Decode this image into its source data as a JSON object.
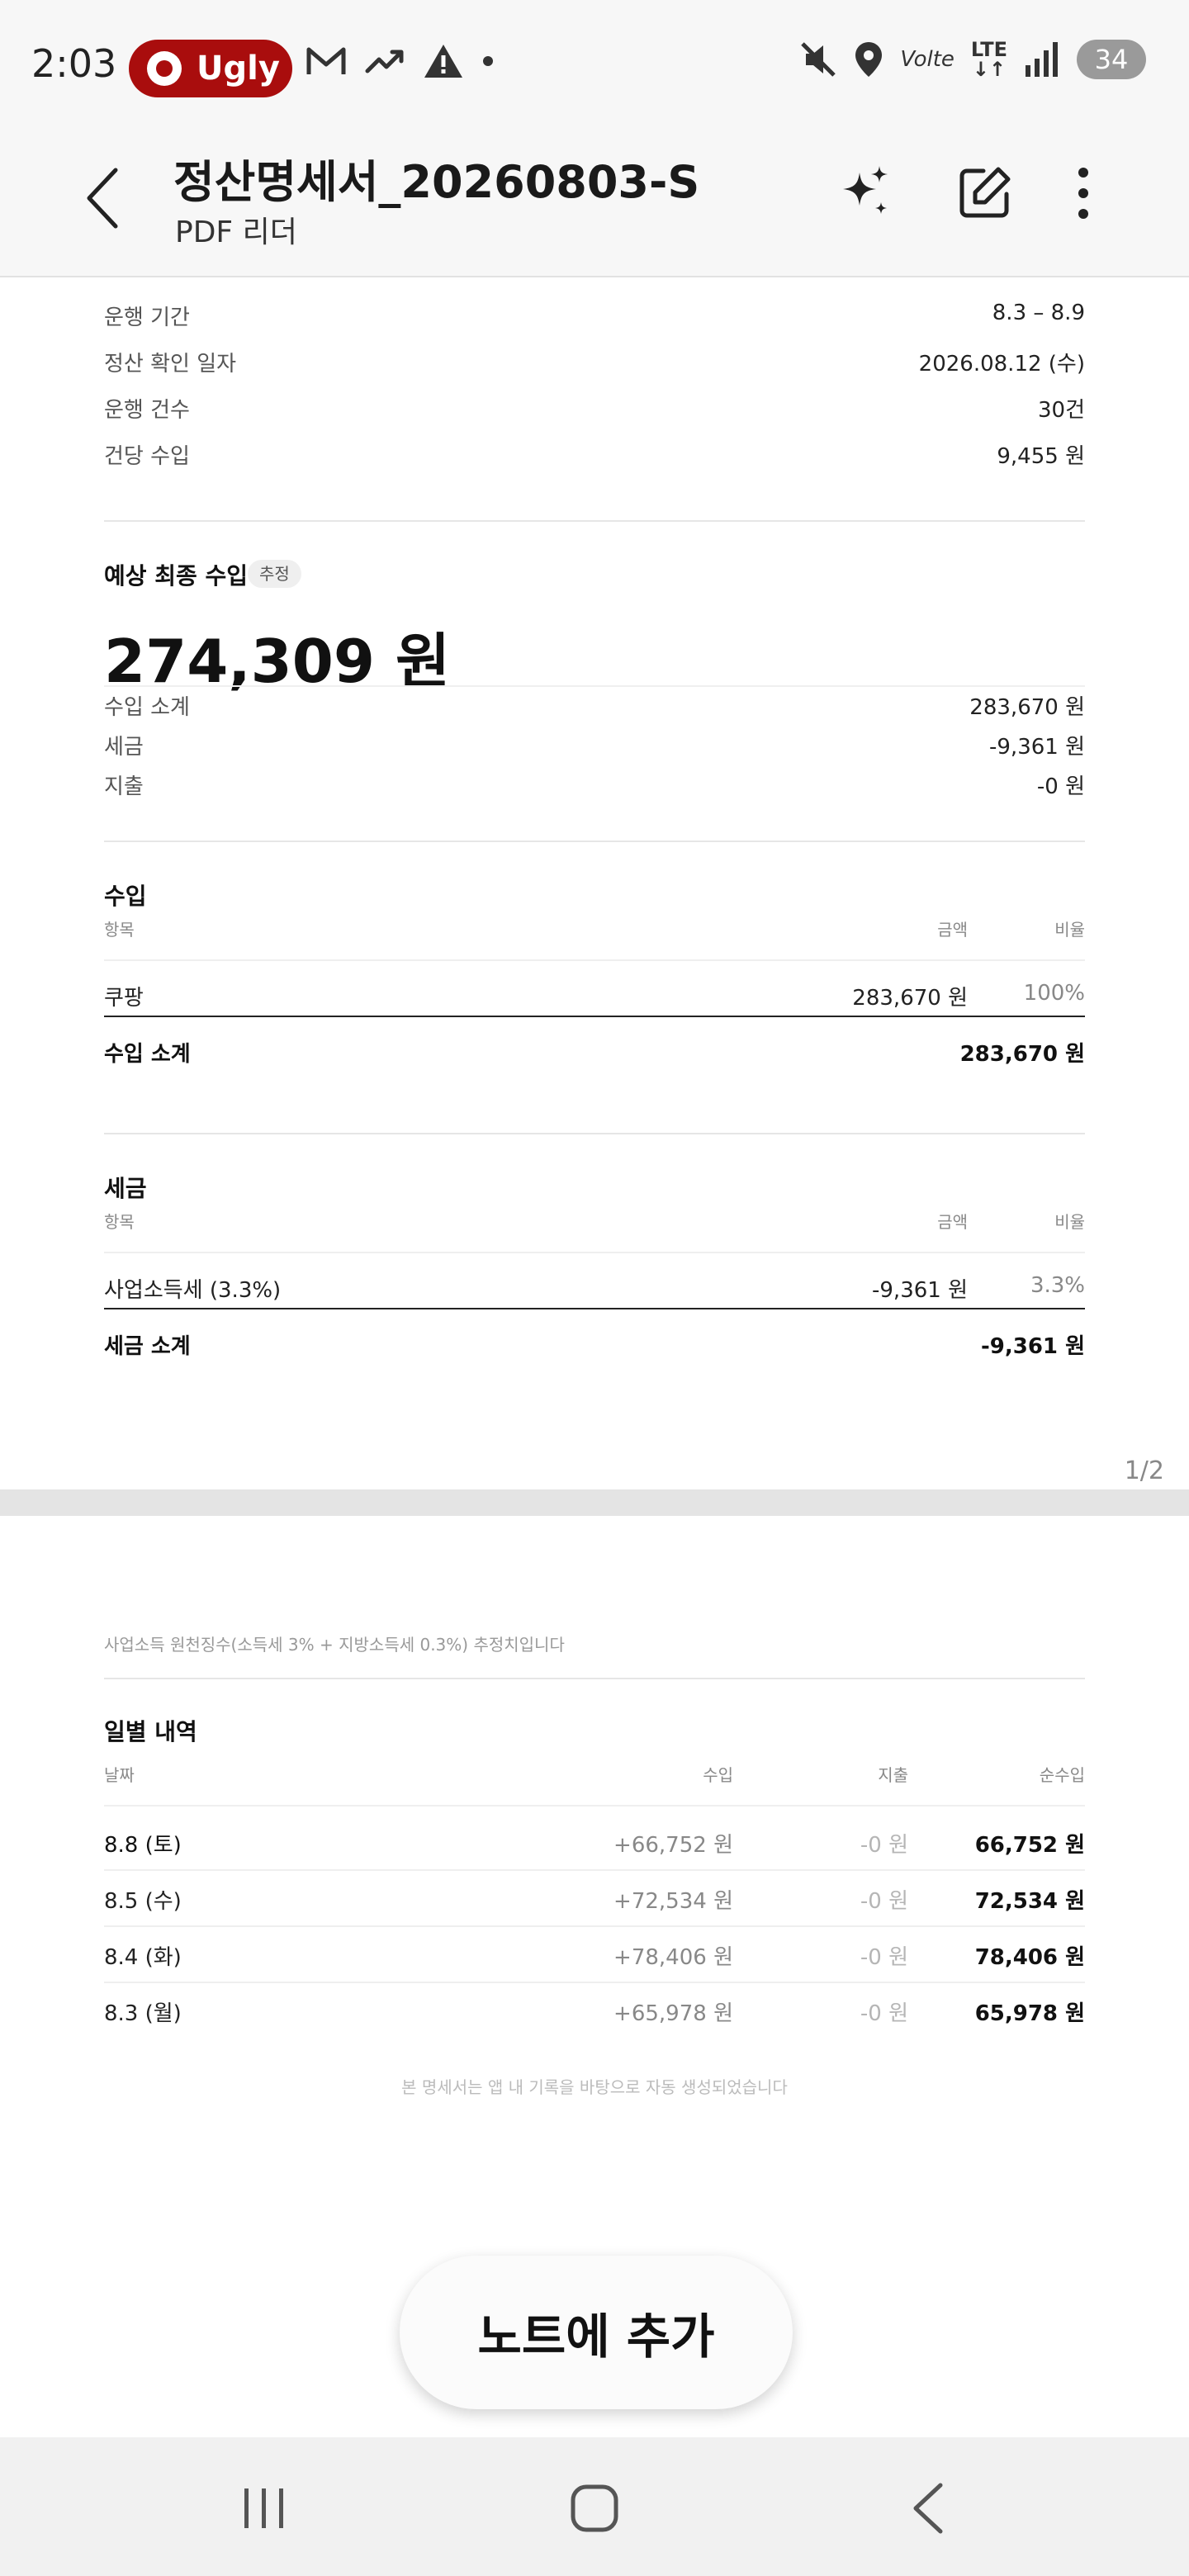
{
  "status_bar": {
    "time": "2:03",
    "pill_label": "Ugly",
    "battery": "34",
    "network": "LTE",
    "volte": "Volte",
    "icons_left": [
      "record-icon",
      "gmail-icon",
      "trending-icon",
      "warning-icon",
      "dot-icon"
    ],
    "icons_right": [
      "mute-icon",
      "location-icon",
      "volte-icon",
      "lte-icon",
      "signal-icon",
      "battery-icon"
    ]
  },
  "app_bar": {
    "title": "정산명세서_20260803-S",
    "subtitle": "PDF 리더",
    "actions": [
      "sparkle-icon",
      "edit-icon",
      "more-icon"
    ]
  },
  "summary": {
    "rows": [
      {
        "label": "운행 기간",
        "value": "8.3 – 8.9"
      },
      {
        "label": "정산 확인 일자",
        "value": "2026.08.12 (수)"
      },
      {
        "label": "운행 건수",
        "value": "30건"
      },
      {
        "label": "건당 수입",
        "value": "9,455 원"
      }
    ]
  },
  "forecast": {
    "title": "예상 최종 수입",
    "badge": "추정",
    "total": "274,309 원",
    "rows": [
      {
        "label": "수입 소계",
        "value": "283,670 원"
      },
      {
        "label": "세금",
        "value": "-9,361 원"
      },
      {
        "label": "지출",
        "value": "-0 원"
      }
    ]
  },
  "income": {
    "title": "수입",
    "headers": {
      "item": "항목",
      "amount": "금액",
      "ratio": "비율"
    },
    "rows": [
      {
        "item": "쿠팡",
        "amount": "283,670 원",
        "ratio": "100%"
      }
    ],
    "subtotal_label": "수입 소계",
    "subtotal_value": "283,670 원"
  },
  "tax": {
    "title": "세금",
    "headers": {
      "item": "항목",
      "amount": "금액",
      "ratio": "비율"
    },
    "rows": [
      {
        "item": "사업소득세 (3.3%)",
        "amount": "-9,361 원",
        "ratio": "3.3%"
      }
    ],
    "subtotal_label": "세금 소계",
    "subtotal_value": "-9,361 원"
  },
  "page_indicator": "1/2",
  "page2": {
    "tax_note": "사업소득 원천징수(소득세 3% + 지방소득세 0.3%) 추정치입니다",
    "daily": {
      "title": "일별 내역",
      "headers": {
        "date": "날짜",
        "income": "수입",
        "expense": "지출",
        "net": "순수입"
      },
      "rows": [
        {
          "date": "8.8 (토)",
          "income": "+66,752 원",
          "expense": "-0 원",
          "net": "66,752 원"
        },
        {
          "date": "8.5 (수)",
          "income": "+72,534 원",
          "expense": "-0 원",
          "net": "72,534 원"
        },
        {
          "date": "8.4 (화)",
          "income": "+78,406 원",
          "expense": "-0 원",
          "net": "78,406 원"
        },
        {
          "date": "8.3 (월)",
          "income": "+65,978 원",
          "expense": "-0 원",
          "net": "65,978 원"
        }
      ]
    },
    "footer": "본 명세서는 앱 내 기록을 바탕으로 자동 생성되었습니다"
  },
  "add_note_button": "노트에 추가",
  "nav_bar": [
    "recents-icon",
    "home-icon",
    "back-icon"
  ]
}
